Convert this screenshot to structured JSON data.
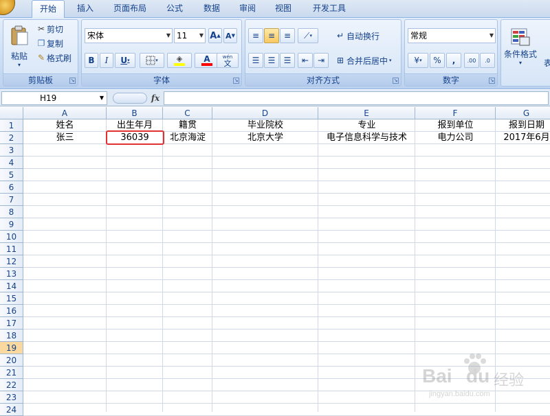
{
  "ribbon": {
    "tabs": [
      {
        "label": "开始",
        "active": true
      },
      {
        "label": "插入"
      },
      {
        "label": "页面布局"
      },
      {
        "label": "公式"
      },
      {
        "label": "数据"
      },
      {
        "label": "审阅"
      },
      {
        "label": "视图"
      },
      {
        "label": "开发工具"
      }
    ],
    "clipboard": {
      "paste": "粘贴",
      "cut": "剪切",
      "copy": "复制",
      "format_painter": "格式刷",
      "group_label": "剪贴板"
    },
    "font": {
      "name": "宋体",
      "size": "11",
      "bold": "B",
      "italic": "I",
      "underline": "U",
      "grow": "A",
      "shrink": "A",
      "font_color_glyph": "A",
      "phonetic": "wén",
      "phonetic_glyph": "文",
      "group_label": "字体",
      "fill_color": "#ffff00",
      "font_color": "#ff0000"
    },
    "alignment": {
      "wrap_text": "自动换行",
      "merge_center": "合并后居中",
      "group_label": "对齐方式"
    },
    "number": {
      "format": "常规",
      "percent": "%",
      "comma": ",",
      "inc_decimal": ".00",
      "dec_decimal": ".0",
      "group_label": "数字"
    },
    "styles": {
      "conditional": "条件格式",
      "table_partial": "表"
    }
  },
  "formula_bar": {
    "name_box": "H19",
    "fx": "fx",
    "content": ""
  },
  "sheet": {
    "columns": [
      "A",
      "B",
      "C",
      "D",
      "E",
      "F",
      "G"
    ],
    "rows": [
      "1",
      "2",
      "3",
      "4",
      "5",
      "6",
      "7",
      "8",
      "9",
      "10",
      "11",
      "12",
      "13",
      "14",
      "15",
      "16",
      "17",
      "18",
      "19",
      "20",
      "21",
      "22",
      "23",
      "24"
    ],
    "selected_row": "19",
    "data": [
      [
        "姓名",
        "出生年月",
        "籍贯",
        "毕业院校",
        "专业",
        "报到单位",
        "报到日期"
      ],
      [
        "张三",
        "36039",
        "北京海淀",
        "北京大学",
        "电子信息科学与技术",
        "电力公司",
        "2017年6月"
      ]
    ],
    "highlighted_cell": "B2"
  },
  "watermark": {
    "brand": "Bai",
    "brand2": "du",
    "suffix": "经验",
    "url": "jingyan.baidu.com"
  }
}
